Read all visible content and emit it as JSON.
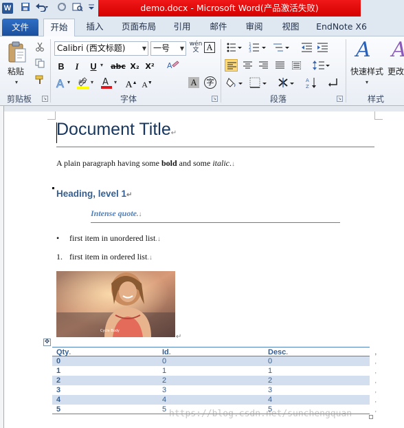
{
  "window": {
    "title": "demo.docx - Microsoft Word(产品激活失败)",
    "app_icon_letter": "W"
  },
  "quick_access": {
    "save_icon": "save-icon",
    "undo_icon": "undo-icon",
    "redo_icon": "redo-icon",
    "customize_icon": "customize-qat-icon"
  },
  "tabs": {
    "file": "文件",
    "items": [
      "开始",
      "插入",
      "页面布局",
      "引用",
      "邮件",
      "审阅",
      "视图",
      "EndNote X6"
    ],
    "active": "开始"
  },
  "ribbon": {
    "clipboard": {
      "paste": "粘贴",
      "group": "剪贴板"
    },
    "font": {
      "name": "Calibri (西文标题)",
      "size": "一号",
      "group": "字体",
      "wen_button": "wén\n文",
      "bold": "B",
      "italic": "I",
      "underline": "U",
      "strike": "abc",
      "subscript": "X₂",
      "superscript": "X²",
      "grow": "A",
      "shrink": "A",
      "char_border": "A",
      "phonetic": "字"
    },
    "paragraph": {
      "group": "段落"
    },
    "styles": {
      "quick_styles": "快速样式",
      "change_styles": "更改",
      "group": "样式"
    }
  },
  "document": {
    "title": "Document Title",
    "paragraph": {
      "lead": "A plain paragraph having some ",
      "bold": "bold",
      "mid": " and some ",
      "italic": "italic",
      "end": "."
    },
    "heading1": "Heading, level 1",
    "quote": "Intense quote",
    "bullet_item": "first item in unordered list",
    "ordered_number": "1.",
    "ordered_item": "first item in ordered list",
    "image_caption": "Cycle Body",
    "table": {
      "headers": [
        "Qty",
        "Id",
        "Desc"
      ],
      "rows": [
        [
          "0",
          "0",
          "0"
        ],
        [
          "1",
          "1",
          "1"
        ],
        [
          "2",
          "2",
          "2"
        ],
        [
          "3",
          "3",
          "3"
        ],
        [
          "4",
          "4",
          "4"
        ],
        [
          "5",
          "5",
          "5"
        ]
      ]
    }
  },
  "watermark": "https://blog.csdn.net/sunchengquan",
  "colors": {
    "accent": "#4f81bd",
    "heading": "#365f91",
    "title": "#17365d",
    "table_shade": "#d3dfee",
    "titlebar_red": "#e00000"
  }
}
